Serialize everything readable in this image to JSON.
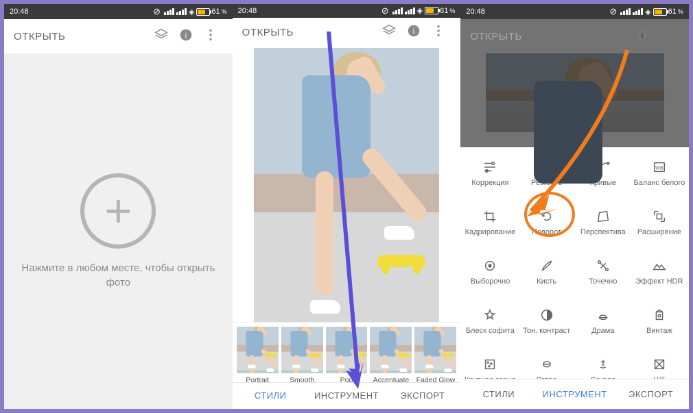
{
  "status": {
    "time": "20:48",
    "battery": "61"
  },
  "toolbar": {
    "open": "ОТКРЫТЬ"
  },
  "screen1": {
    "hint": "Нажмите в любом месте, чтобы открыть фото"
  },
  "styles": [
    {
      "label": "Portrait"
    },
    {
      "label": "Smooth"
    },
    {
      "label": "Pop"
    },
    {
      "label": "Accentuate"
    },
    {
      "label": "Faded Glow"
    }
  ],
  "tabs": {
    "styles": "СТИЛИ",
    "tools": "ИНСТРУМЕНТ",
    "export": "ЭКСПОРТ"
  },
  "tools": [
    {
      "label": "Коррекция",
      "icon": "tune"
    },
    {
      "label": "Резкость",
      "icon": "details"
    },
    {
      "label": "Кривые",
      "icon": "curves"
    },
    {
      "label": "Баланс белого",
      "icon": "wb"
    },
    {
      "label": "Кадрирование",
      "icon": "crop"
    },
    {
      "label": "Поворот",
      "icon": "rotate"
    },
    {
      "label": "Перспектива",
      "icon": "perspective"
    },
    {
      "label": "Расширение",
      "icon": "expand"
    },
    {
      "label": "Выборочно",
      "icon": "target"
    },
    {
      "label": "Кисть",
      "icon": "brush"
    },
    {
      "label": "Точечно",
      "icon": "heal"
    },
    {
      "label": "Эффект HDR",
      "icon": "hdr"
    },
    {
      "label": "Блеск софита",
      "icon": "glamour"
    },
    {
      "label": "Тон. контраст",
      "icon": "contrast"
    },
    {
      "label": "Драма",
      "icon": "drama"
    },
    {
      "label": "Винтаж",
      "icon": "vintage"
    },
    {
      "label": "Крупное зерно",
      "icon": "grain"
    },
    {
      "label": "Ретро",
      "icon": "retro"
    },
    {
      "label": "Grunge",
      "icon": "grunge"
    },
    {
      "label": "Ч/б",
      "icon": "bw"
    }
  ],
  "annotation": {
    "highlight_tool": "Поворот"
  }
}
